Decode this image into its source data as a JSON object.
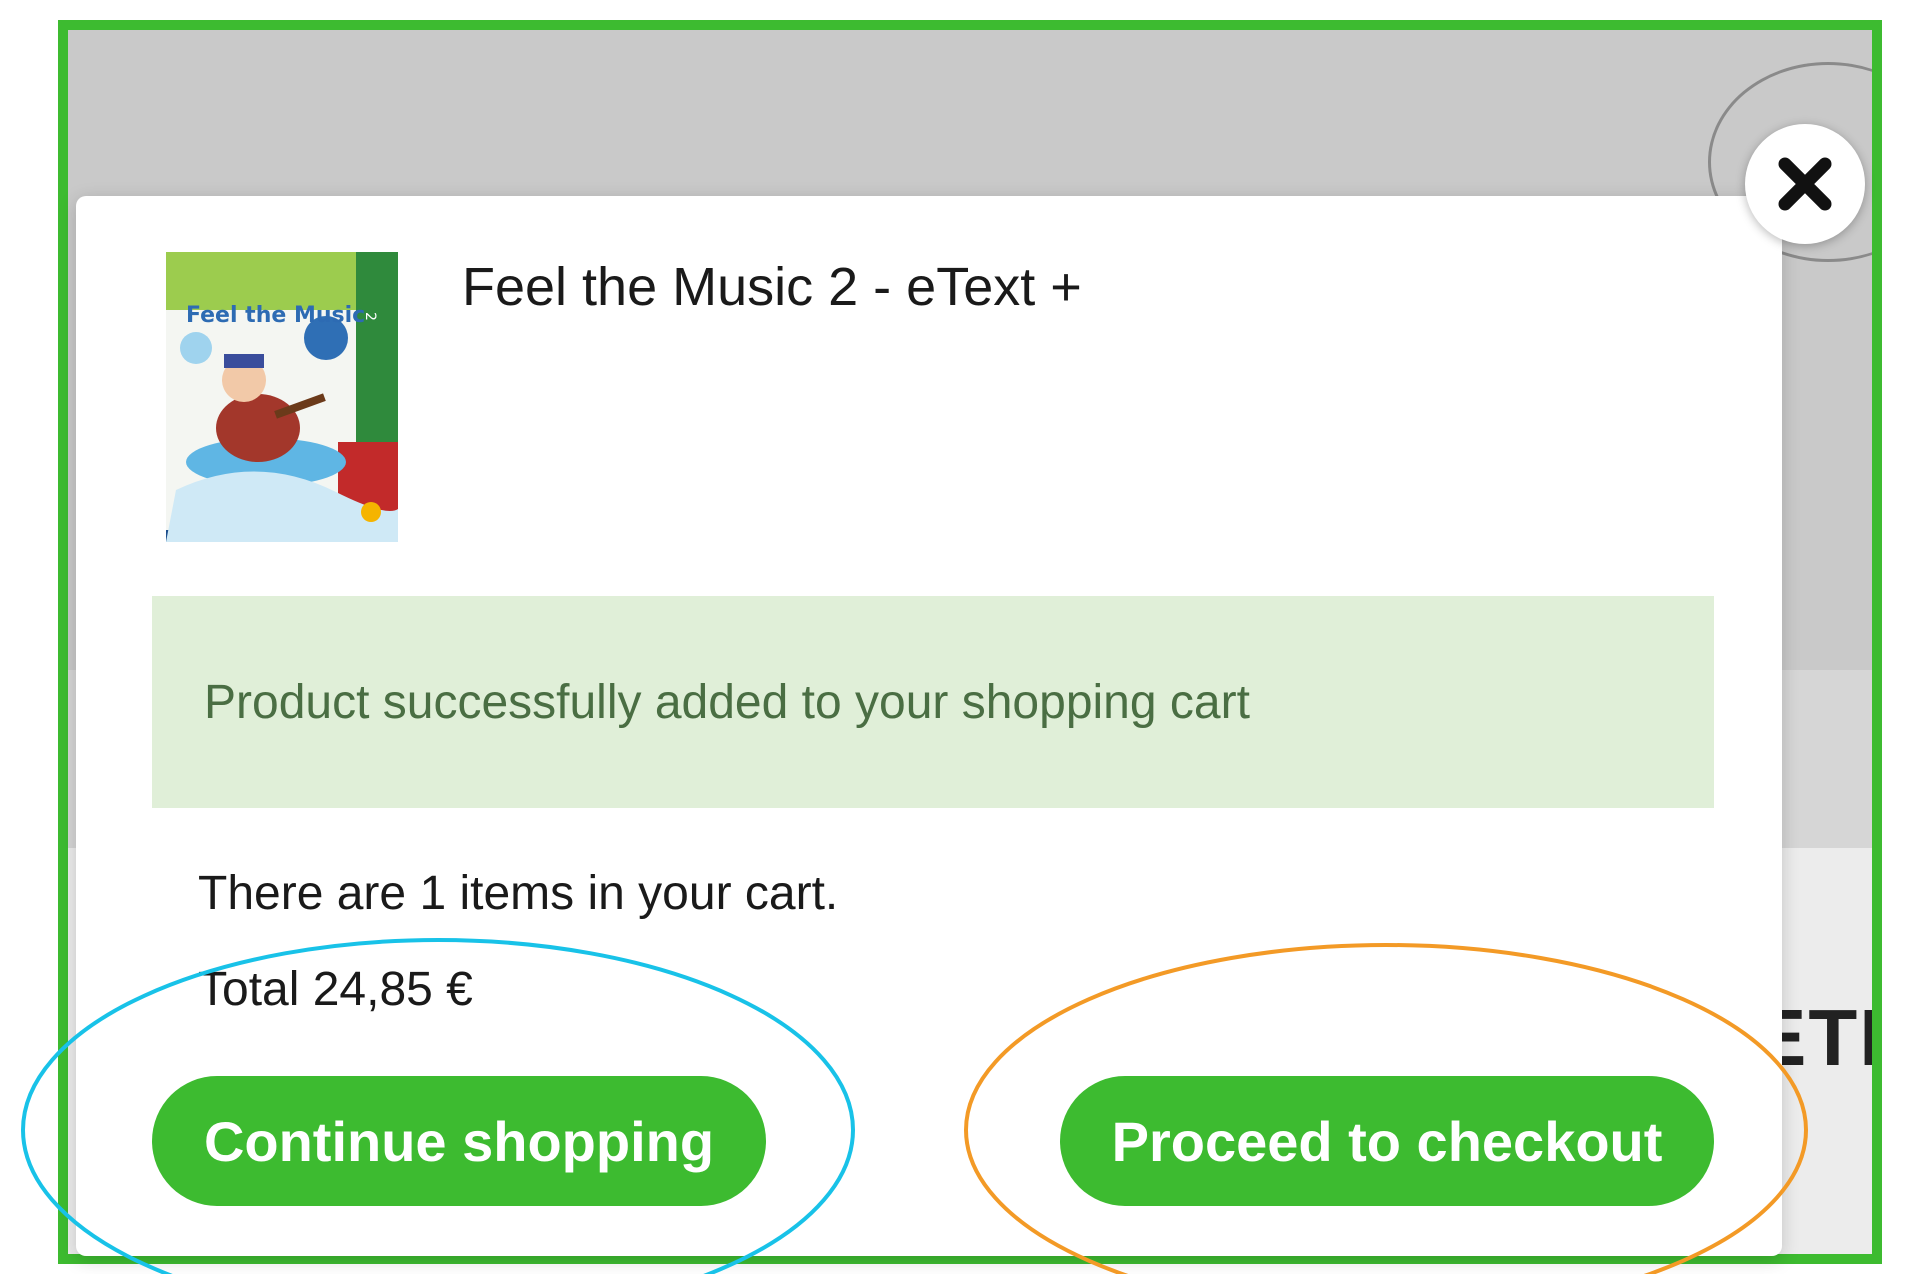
{
  "product": {
    "name": "Feel the Music 2 - eText +",
    "thumbnail": "book-cover-image"
  },
  "alert": {
    "message": "Product successfully added to your shopping cart"
  },
  "cart": {
    "count_text": "There are 1 items in your cart.",
    "total_text": "Total 24,85 €"
  },
  "buttons": {
    "continue_label": "Continue shopping",
    "checkout_label": "Proceed to checkout"
  },
  "icons": {
    "close": "close-icon"
  },
  "colors": {
    "brand_green": "#3dbb30",
    "alert_bg": "#e0efd8",
    "alert_text": "#4a6e43",
    "annotation_continue": "#18c2e8",
    "annotation_checkout": "#f39a26",
    "annotation_frame": "#3dbb30"
  }
}
